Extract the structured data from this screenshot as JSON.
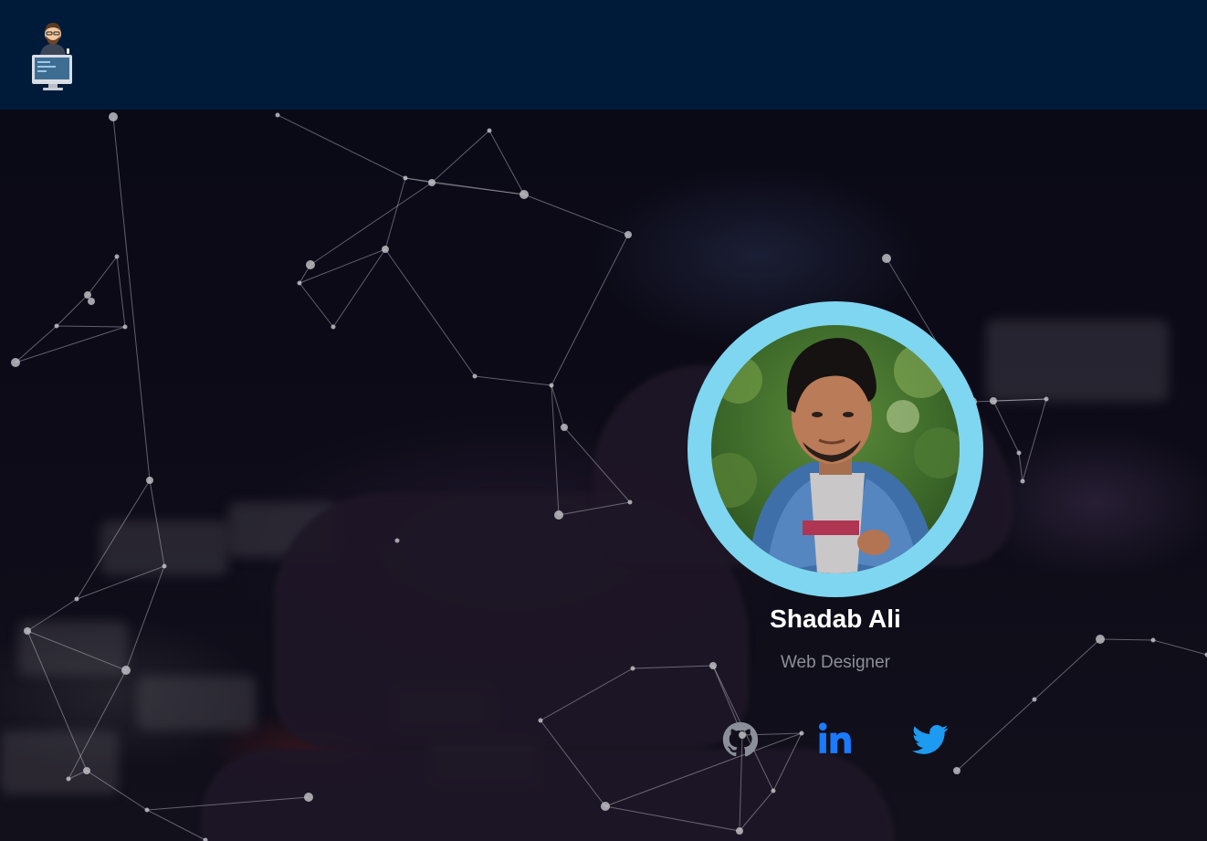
{
  "navbar": {
    "logo_icon": "developer-avatar-logo-icon"
  },
  "profile": {
    "name": "Shadab Ali",
    "role": "Web Designer",
    "photo_icon": "profile-photo",
    "ring_color": "#7fd6f0"
  },
  "social_links": [
    {
      "name": "github",
      "icon": "github-icon",
      "color": "#8a8f99"
    },
    {
      "name": "linkedin",
      "icon": "linkedin-icon",
      "color": "#1a7bff"
    },
    {
      "name": "twitter",
      "icon": "twitter-icon",
      "color": "#1d9bf0"
    }
  ],
  "colors": {
    "navbar_bg": "#001a3a",
    "accent": "#7fd6f0",
    "name_text": "#ffffff",
    "role_text": "#8c8f98"
  }
}
